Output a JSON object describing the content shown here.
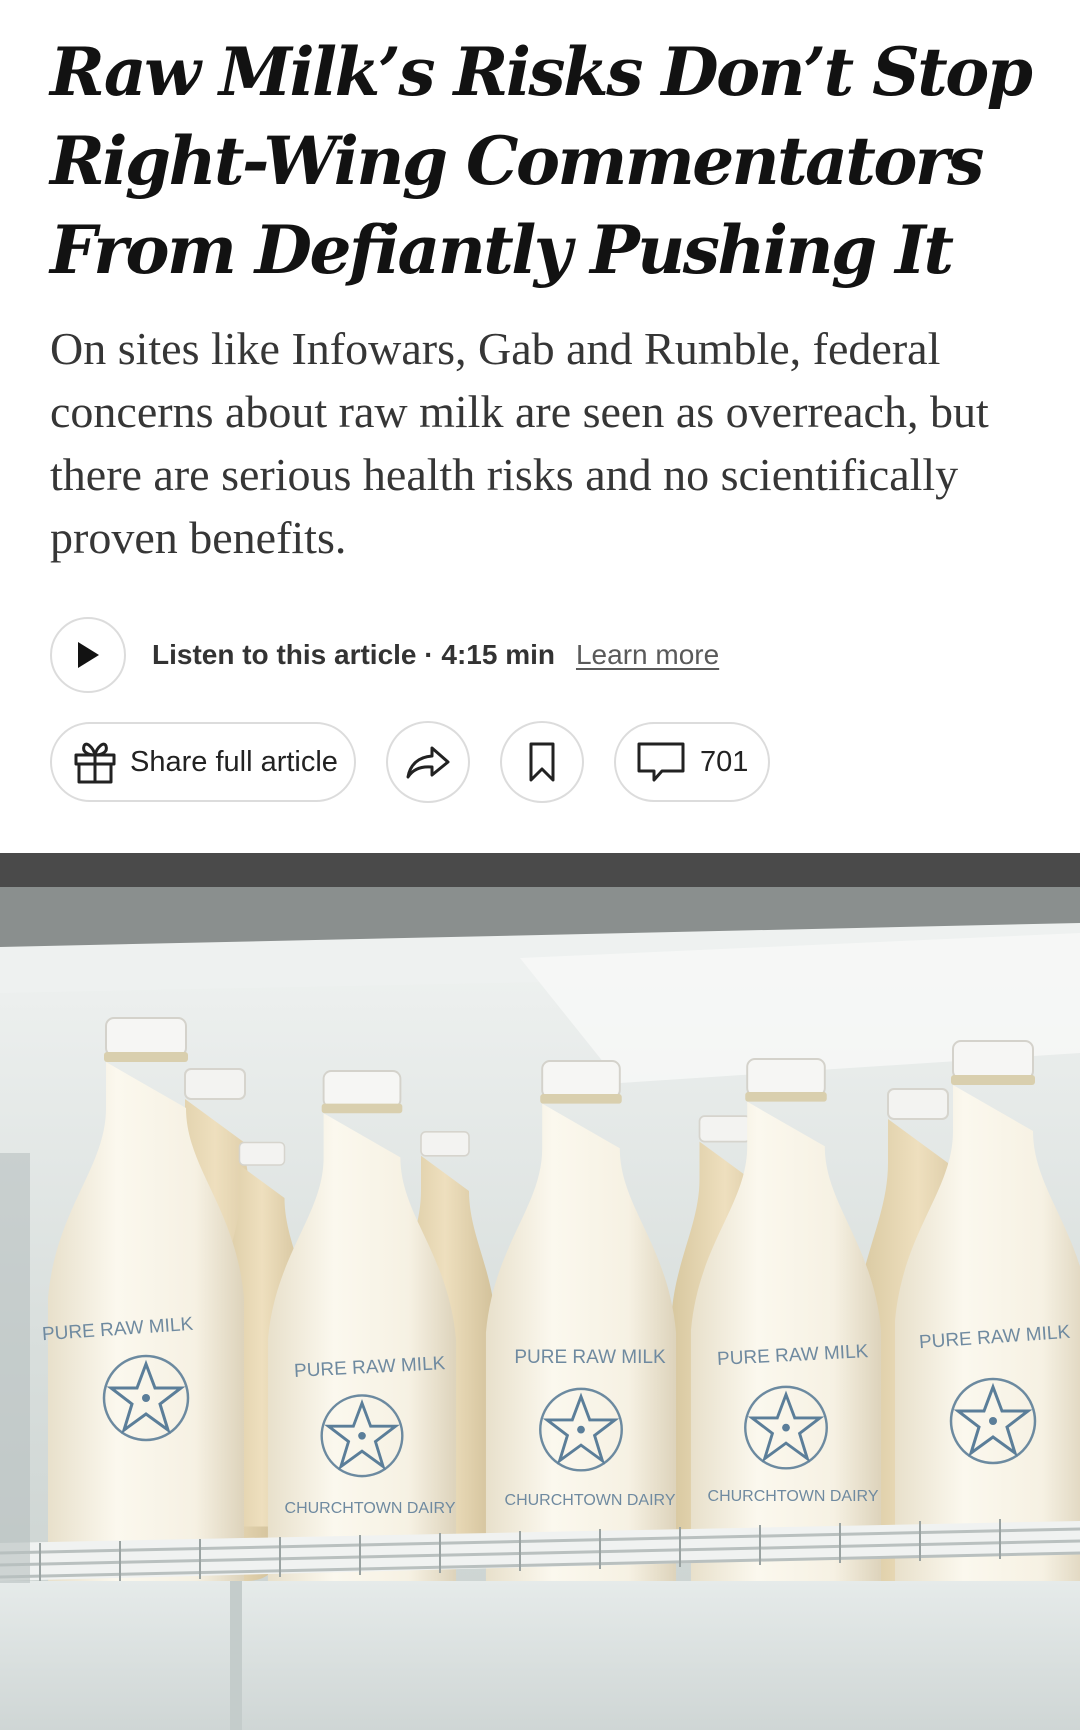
{
  "article": {
    "headline": "Raw Milk’s Risks Don’t Stop Right-Wing Commentators From Defiantly Pushing It",
    "summary": "On sites like Infowars, Gab and Rumble, federal concerns about raw milk are seen as overreach, but there are serious health risks and no scientifically proven benefits."
  },
  "audio": {
    "play_icon": "play-icon",
    "listen_label": "Listen to this article · 4:15 min",
    "learn_more_label": "Learn more"
  },
  "actions": {
    "share_label": "Share full article",
    "share_icon": "gift-icon",
    "forward_icon": "forward-arrow-icon",
    "bookmark_icon": "bookmark-icon",
    "comment_icon": "comment-icon",
    "comment_count": "701"
  },
  "photo": {
    "bottle_label_top": "PURE RAW MILK",
    "bottle_label_bottom": "CHURCHTOWN DAIRY",
    "bottle_color": "#f7f2e4",
    "cap_color": "#f4f4f2"
  }
}
